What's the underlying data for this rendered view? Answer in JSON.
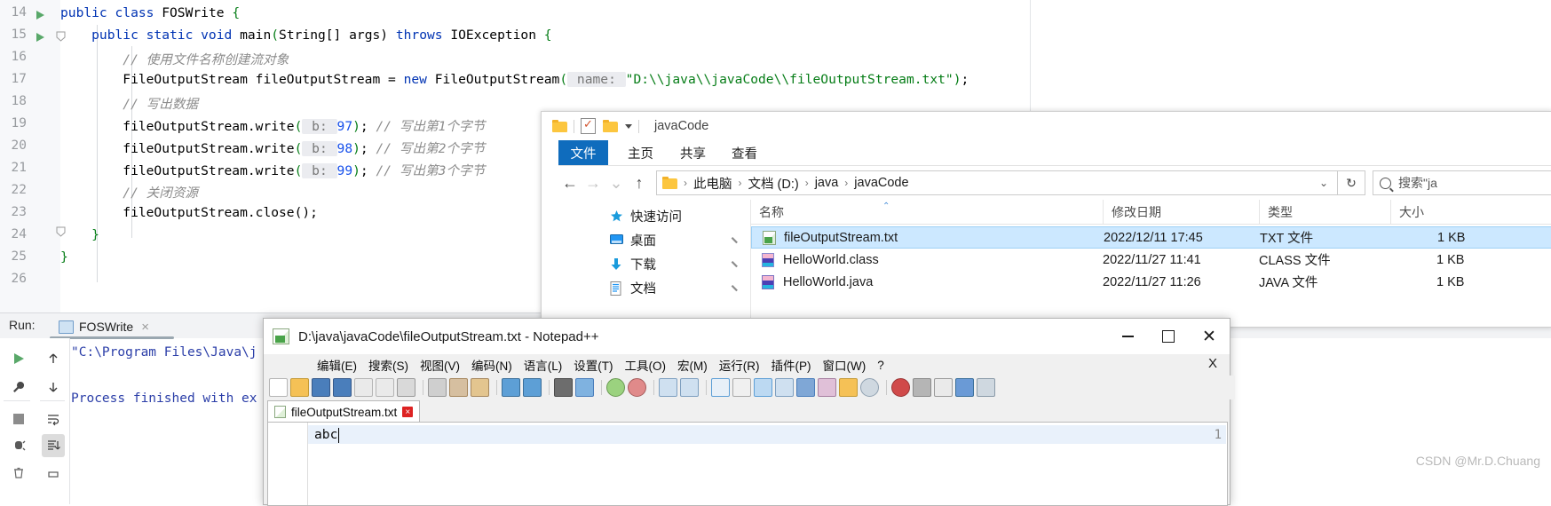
{
  "ide": {
    "gutter_lines": [
      "14",
      "15",
      "16",
      "17",
      "18",
      "19",
      "20",
      "21",
      "22",
      "23",
      "24",
      "25",
      "26"
    ],
    "code_lines": [
      {
        "n": "14",
        "segs": [
          {
            "t": "public ",
            "c": "kw"
          },
          {
            "t": "class ",
            "c": "kw"
          },
          {
            "t": "FOSWrite ",
            "c": "cls"
          },
          {
            "t": "{",
            "c": "brk"
          }
        ]
      },
      {
        "n": "15",
        "segs": [
          {
            "t": "    public static void ",
            "c": "kw"
          },
          {
            "t": "main",
            "c": "cls"
          },
          {
            "t": "(",
            "c": "brk"
          },
          {
            "t": "String",
            "c": "cls"
          },
          {
            "t": "[] args) ",
            "c": "cls"
          },
          {
            "t": "throws ",
            "c": "kw"
          },
          {
            "t": "IOException ",
            "c": "cls"
          },
          {
            "t": "{",
            "c": "brk"
          }
        ]
      },
      {
        "n": "16",
        "segs": [
          {
            "t": "        // 使用文件名称创建流对象",
            "c": "cmt"
          }
        ]
      },
      {
        "n": "17",
        "segs": [
          {
            "t": "        FileOutputStream fileOutputStream = ",
            "c": "cls"
          },
          {
            "t": "new ",
            "c": "kw"
          },
          {
            "t": "FileOutputStream",
            "c": "cls"
          },
          {
            "t": "(",
            "c": "brk"
          },
          {
            "t": " name: ",
            "c": "param"
          },
          {
            "t": "\"D:\\\\java\\\\javaCode\\\\fileOutputStream.txt\"",
            "c": "str"
          },
          {
            "t": ")",
            "c": "brk"
          },
          {
            "t": ";",
            "c": "cls"
          }
        ]
      },
      {
        "n": "18",
        "segs": [
          {
            "t": "        // 写出数据",
            "c": "cmt"
          }
        ]
      },
      {
        "n": "19",
        "segs": [
          {
            "t": "        fileOutputStream.write",
            "c": "cls"
          },
          {
            "t": "(",
            "c": "brk"
          },
          {
            "t": " b: ",
            "c": "param"
          },
          {
            "t": "97",
            "c": "num"
          },
          {
            "t": ")",
            "c": "brk"
          },
          {
            "t": "; ",
            "c": "cls"
          },
          {
            "t": "// 写出第1个字节",
            "c": "cmt"
          }
        ]
      },
      {
        "n": "20",
        "segs": [
          {
            "t": "        fileOutputStream.write",
            "c": "cls"
          },
          {
            "t": "(",
            "c": "brk"
          },
          {
            "t": " b: ",
            "c": "param"
          },
          {
            "t": "98",
            "c": "num"
          },
          {
            "t": ")",
            "c": "brk"
          },
          {
            "t": "; ",
            "c": "cls"
          },
          {
            "t": "// 写出第2个字节",
            "c": "cmt"
          }
        ]
      },
      {
        "n": "21",
        "segs": [
          {
            "t": "        fileOutputStream.write",
            "c": "cls"
          },
          {
            "t": "(",
            "c": "brk"
          },
          {
            "t": " b: ",
            "c": "param"
          },
          {
            "t": "99",
            "c": "num"
          },
          {
            "t": ")",
            "c": "brk"
          },
          {
            "t": "; ",
            "c": "cls"
          },
          {
            "t": "// 写出第3个字节",
            "c": "cmt"
          }
        ]
      },
      {
        "n": "22",
        "segs": [
          {
            "t": "        // 关闭资源",
            "c": "cmt"
          }
        ]
      },
      {
        "n": "23",
        "segs": [
          {
            "t": "        fileOutputStream.close();",
            "c": "cls"
          }
        ]
      },
      {
        "n": "24",
        "segs": [
          {
            "t": "    }",
            "c": "brk"
          }
        ]
      },
      {
        "n": "25",
        "segs": [
          {
            "t": "}",
            "c": "brk"
          }
        ]
      },
      {
        "n": "26",
        "segs": []
      }
    ],
    "run": {
      "label": "Run:",
      "tab_label": "FOSWrite",
      "tab_close": "×",
      "output_line1": "\"C:\\Program Files\\Java\\j",
      "output_line2": "Process finished with ex"
    }
  },
  "explorer": {
    "title": "javaCode",
    "ribbon_tabs": [
      "文件",
      "主页",
      "共享",
      "查看"
    ],
    "nav": {
      "back": "←",
      "forward": "→",
      "recent": "⌄",
      "up": "↑"
    },
    "breadcrumbs": [
      "此电脑",
      "文档 (D:)",
      "java",
      "javaCode"
    ],
    "breadcrumb_sep": "›",
    "address_caret": "⌄",
    "refresh": "↻",
    "search_placeholder": "搜索\"ja",
    "sidebar": [
      {
        "label": "快速访问",
        "icon": "star-icon",
        "pinned": false
      },
      {
        "label": "桌面",
        "icon": "desktop-icon",
        "pinned": true
      },
      {
        "label": "下载",
        "icon": "download-icon",
        "pinned": true
      },
      {
        "label": "文档",
        "icon": "documents-icon",
        "pinned": true
      }
    ],
    "columns": [
      "名称",
      "修改日期",
      "类型",
      "大小"
    ],
    "sort_caret": "⌃",
    "files": [
      {
        "name": "fileOutputStream.txt",
        "modified": "2022/12/11 17:45",
        "type": "TXT 文件",
        "size": "1 KB",
        "icon": "txt-file-icon",
        "selected": true
      },
      {
        "name": "HelloWorld.class",
        "modified": "2022/11/27 11:41",
        "type": "CLASS 文件",
        "size": "1 KB",
        "icon": "class-file-icon",
        "selected": false
      },
      {
        "name": "HelloWorld.java",
        "modified": "2022/11/27 11:26",
        "type": "JAVA 文件",
        "size": "1 KB",
        "icon": "java-file-icon",
        "selected": false
      }
    ]
  },
  "notepadpp": {
    "title": "D:\\java\\javaCode\\fileOutputStream.txt - Notepad++",
    "window_buttons": {
      "minimize": "–",
      "maximize": "☐",
      "close": "✕"
    },
    "menu_items": [
      "编辑(E)",
      "搜索(S)",
      "视图(V)",
      "编码(N)",
      "语言(L)",
      "设置(T)",
      "工具(O)",
      "宏(M)",
      "运行(R)",
      "插件(P)",
      "窗口(W)",
      "?"
    ],
    "menu_close_x": "X",
    "tab_label": "fileOutputStream.txt",
    "tab_close": "×",
    "line_number": "1",
    "content": "abc"
  },
  "watermark": "CSDN @Mr.D.Chuang",
  "colors": {
    "accent_blue": "#0f6cbd",
    "selection_blue": "#cce8ff",
    "keyword": "#0033b3",
    "string": "#067d17",
    "comment": "#8c8c8c",
    "number": "#1750eb",
    "console_text": "#2b3ea8"
  }
}
